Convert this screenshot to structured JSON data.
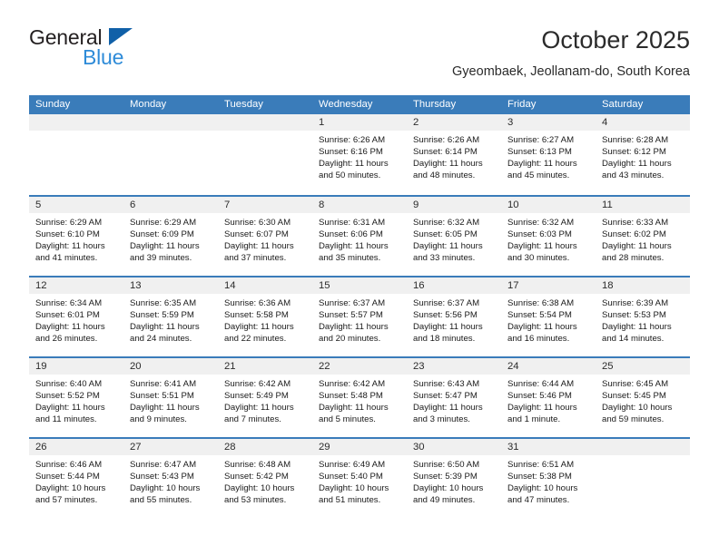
{
  "logo": {
    "primary_text": "General",
    "secondary_text": "Blue",
    "triangle_color": "#1060a8",
    "secondary_color": "#2e8bd8"
  },
  "header": {
    "month_title": "October 2025",
    "location": "Gyeombaek, Jeollanam-do, South Korea"
  },
  "theme": {
    "header_blue": "#3a7cba",
    "day_band_gray": "#f0f0f0",
    "text_dark": "#2b2b2b"
  },
  "weekdays": [
    "Sunday",
    "Monday",
    "Tuesday",
    "Wednesday",
    "Thursday",
    "Friday",
    "Saturday"
  ],
  "weeks": [
    [
      {
        "day": "",
        "empty": true
      },
      {
        "day": "",
        "empty": true
      },
      {
        "day": "",
        "empty": true
      },
      {
        "day": "1",
        "sunrise": "Sunrise: 6:26 AM",
        "sunset": "Sunset: 6:16 PM",
        "daylight": "Daylight: 11 hours and 50 minutes."
      },
      {
        "day": "2",
        "sunrise": "Sunrise: 6:26 AM",
        "sunset": "Sunset: 6:14 PM",
        "daylight": "Daylight: 11 hours and 48 minutes."
      },
      {
        "day": "3",
        "sunrise": "Sunrise: 6:27 AM",
        "sunset": "Sunset: 6:13 PM",
        "daylight": "Daylight: 11 hours and 45 minutes."
      },
      {
        "day": "4",
        "sunrise": "Sunrise: 6:28 AM",
        "sunset": "Sunset: 6:12 PM",
        "daylight": "Daylight: 11 hours and 43 minutes."
      }
    ],
    [
      {
        "day": "5",
        "sunrise": "Sunrise: 6:29 AM",
        "sunset": "Sunset: 6:10 PM",
        "daylight": "Daylight: 11 hours and 41 minutes."
      },
      {
        "day": "6",
        "sunrise": "Sunrise: 6:29 AM",
        "sunset": "Sunset: 6:09 PM",
        "daylight": "Daylight: 11 hours and 39 minutes."
      },
      {
        "day": "7",
        "sunrise": "Sunrise: 6:30 AM",
        "sunset": "Sunset: 6:07 PM",
        "daylight": "Daylight: 11 hours and 37 minutes."
      },
      {
        "day": "8",
        "sunrise": "Sunrise: 6:31 AM",
        "sunset": "Sunset: 6:06 PM",
        "daylight": "Daylight: 11 hours and 35 minutes."
      },
      {
        "day": "9",
        "sunrise": "Sunrise: 6:32 AM",
        "sunset": "Sunset: 6:05 PM",
        "daylight": "Daylight: 11 hours and 33 minutes."
      },
      {
        "day": "10",
        "sunrise": "Sunrise: 6:32 AM",
        "sunset": "Sunset: 6:03 PM",
        "daylight": "Daylight: 11 hours and 30 minutes."
      },
      {
        "day": "11",
        "sunrise": "Sunrise: 6:33 AM",
        "sunset": "Sunset: 6:02 PM",
        "daylight": "Daylight: 11 hours and 28 minutes."
      }
    ],
    [
      {
        "day": "12",
        "sunrise": "Sunrise: 6:34 AM",
        "sunset": "Sunset: 6:01 PM",
        "daylight": "Daylight: 11 hours and 26 minutes."
      },
      {
        "day": "13",
        "sunrise": "Sunrise: 6:35 AM",
        "sunset": "Sunset: 5:59 PM",
        "daylight": "Daylight: 11 hours and 24 minutes."
      },
      {
        "day": "14",
        "sunrise": "Sunrise: 6:36 AM",
        "sunset": "Sunset: 5:58 PM",
        "daylight": "Daylight: 11 hours and 22 minutes."
      },
      {
        "day": "15",
        "sunrise": "Sunrise: 6:37 AM",
        "sunset": "Sunset: 5:57 PM",
        "daylight": "Daylight: 11 hours and 20 minutes."
      },
      {
        "day": "16",
        "sunrise": "Sunrise: 6:37 AM",
        "sunset": "Sunset: 5:56 PM",
        "daylight": "Daylight: 11 hours and 18 minutes."
      },
      {
        "day": "17",
        "sunrise": "Sunrise: 6:38 AM",
        "sunset": "Sunset: 5:54 PM",
        "daylight": "Daylight: 11 hours and 16 minutes."
      },
      {
        "day": "18",
        "sunrise": "Sunrise: 6:39 AM",
        "sunset": "Sunset: 5:53 PM",
        "daylight": "Daylight: 11 hours and 14 minutes."
      }
    ],
    [
      {
        "day": "19",
        "sunrise": "Sunrise: 6:40 AM",
        "sunset": "Sunset: 5:52 PM",
        "daylight": "Daylight: 11 hours and 11 minutes."
      },
      {
        "day": "20",
        "sunrise": "Sunrise: 6:41 AM",
        "sunset": "Sunset: 5:51 PM",
        "daylight": "Daylight: 11 hours and 9 minutes."
      },
      {
        "day": "21",
        "sunrise": "Sunrise: 6:42 AM",
        "sunset": "Sunset: 5:49 PM",
        "daylight": "Daylight: 11 hours and 7 minutes."
      },
      {
        "day": "22",
        "sunrise": "Sunrise: 6:42 AM",
        "sunset": "Sunset: 5:48 PM",
        "daylight": "Daylight: 11 hours and 5 minutes."
      },
      {
        "day": "23",
        "sunrise": "Sunrise: 6:43 AM",
        "sunset": "Sunset: 5:47 PM",
        "daylight": "Daylight: 11 hours and 3 minutes."
      },
      {
        "day": "24",
        "sunrise": "Sunrise: 6:44 AM",
        "sunset": "Sunset: 5:46 PM",
        "daylight": "Daylight: 11 hours and 1 minute."
      },
      {
        "day": "25",
        "sunrise": "Sunrise: 6:45 AM",
        "sunset": "Sunset: 5:45 PM",
        "daylight": "Daylight: 10 hours and 59 minutes."
      }
    ],
    [
      {
        "day": "26",
        "sunrise": "Sunrise: 6:46 AM",
        "sunset": "Sunset: 5:44 PM",
        "daylight": "Daylight: 10 hours and 57 minutes."
      },
      {
        "day": "27",
        "sunrise": "Sunrise: 6:47 AM",
        "sunset": "Sunset: 5:43 PM",
        "daylight": "Daylight: 10 hours and 55 minutes."
      },
      {
        "day": "28",
        "sunrise": "Sunrise: 6:48 AM",
        "sunset": "Sunset: 5:42 PM",
        "daylight": "Daylight: 10 hours and 53 minutes."
      },
      {
        "day": "29",
        "sunrise": "Sunrise: 6:49 AM",
        "sunset": "Sunset: 5:40 PM",
        "daylight": "Daylight: 10 hours and 51 minutes."
      },
      {
        "day": "30",
        "sunrise": "Sunrise: 6:50 AM",
        "sunset": "Sunset: 5:39 PM",
        "daylight": "Daylight: 10 hours and 49 minutes."
      },
      {
        "day": "31",
        "sunrise": "Sunrise: 6:51 AM",
        "sunset": "Sunset: 5:38 PM",
        "daylight": "Daylight: 10 hours and 47 minutes."
      },
      {
        "day": "",
        "empty": true
      }
    ]
  ]
}
